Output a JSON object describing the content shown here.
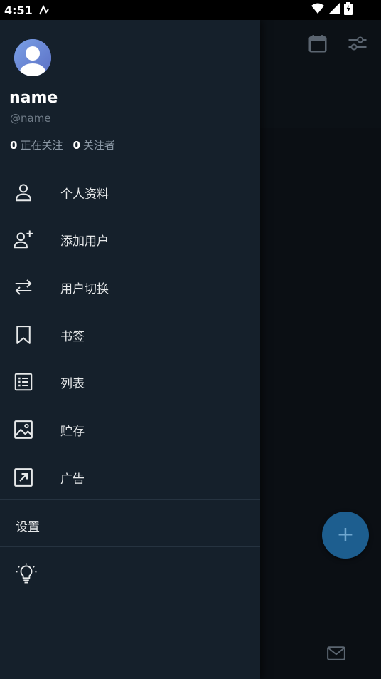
{
  "status_bar": {
    "time": "4:51"
  },
  "profile": {
    "display_name": "name",
    "handle": "@name",
    "following_count": "0",
    "following_label": "正在关注",
    "followers_count": "0",
    "followers_label": "关注者"
  },
  "menu": {
    "items": [
      {
        "label": "个人资料",
        "icon": "person-icon"
      },
      {
        "label": "添加用户",
        "icon": "person-add-icon"
      },
      {
        "label": "用户切换",
        "icon": "swap-icon"
      },
      {
        "label": "书签",
        "icon": "bookmark-icon"
      },
      {
        "label": "列表",
        "icon": "list-icon"
      },
      {
        "label": "贮存",
        "icon": "image-icon"
      },
      {
        "label": "广告",
        "icon": "external-link-icon"
      }
    ],
    "settings_label": "设置"
  },
  "fab": {
    "label": "+"
  },
  "colors": {
    "drawer_bg": "#15202b",
    "fab": "#1d5e8f"
  }
}
